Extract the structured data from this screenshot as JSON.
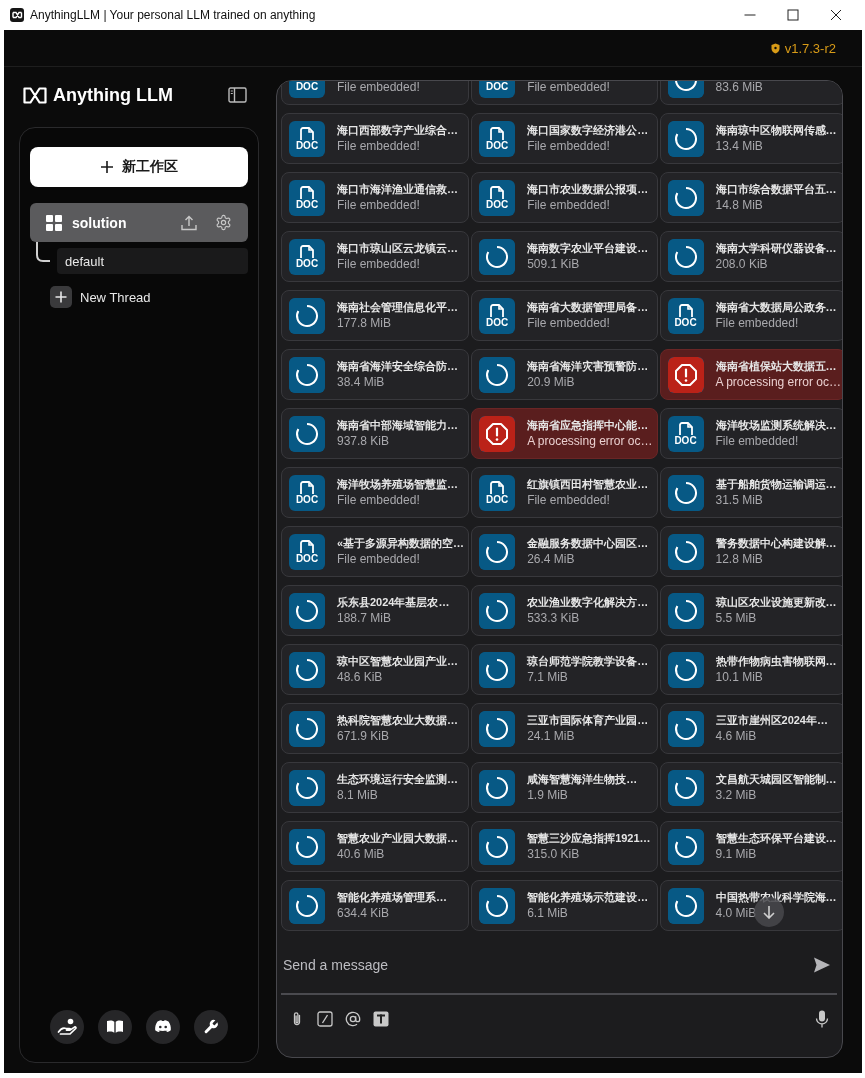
{
  "window": {
    "title": "AnythingLLM | Your personal LLM trained on anything"
  },
  "header": {
    "version": "v1.7.3-r2"
  },
  "sidebar": {
    "logo": "Anything LLM",
    "new_workspace_button": "新工作区",
    "workspaces": [
      {
        "name": "solution",
        "selected": true,
        "threads": [
          {
            "name": "default",
            "selected": true
          }
        ]
      }
    ],
    "new_thread_button": "New Thread"
  },
  "files": [
    {
      "kind": "doc",
      "icon_label": "DOC",
      "status": "File embedded!"
    },
    {
      "kind": "doc",
      "icon_label": "DOC",
      "status": "File embedded!"
    },
    {
      "kind": "loading",
      "status": "83.6 MiB"
    },
    {
      "kind": "doc",
      "icon_label": "DOC",
      "name": "海口西部数字产业综合…",
      "status": "File embedded!"
    },
    {
      "kind": "doc",
      "icon_label": "DOC",
      "name": "海口国家数字经济港公…",
      "status": "File embedded!"
    },
    {
      "kind": "loading",
      "name": "海南琼中区物联网传感…",
      "status": "13.4 MiB"
    },
    {
      "kind": "doc",
      "icon_label": "DOC",
      "name": "海口市海洋渔业通信救…",
      "status": "File embedded!"
    },
    {
      "kind": "doc",
      "icon_label": "DOC",
      "name": "海口市农业数据公报项…",
      "status": "File embedded!"
    },
    {
      "kind": "loading",
      "name": "海口市综合数据平台五…",
      "status": "14.8 MiB"
    },
    {
      "kind": "doc",
      "icon_label": "DOC",
      "name": "海口市琼山区云龙镇云…",
      "status": "File embedded!"
    },
    {
      "kind": "loading",
      "name": "海南数字农业平台建设…",
      "status": "509.1 KiB"
    },
    {
      "kind": "loading",
      "name": "海南大学科研仪器设备…",
      "status": "208.0 KiB"
    },
    {
      "kind": "loading",
      "name": "海南社会管理信息化平…",
      "status": "177.8 MiB"
    },
    {
      "kind": "doc",
      "icon_label": "DOC",
      "name": "海南省大数据管理局备…",
      "status": "File embedded!"
    },
    {
      "kind": "doc",
      "icon_label": "DOC",
      "name": "海南省大数据局公政务…",
      "status": "File embedded!"
    },
    {
      "kind": "loading",
      "name": "海南省海洋安全综合防…",
      "status": "38.4 MiB"
    },
    {
      "kind": "loading",
      "name": "海南省海洋灾害预警防…",
      "status": "20.9 MiB"
    },
    {
      "kind": "error",
      "name": "海南省植保站大数据五…",
      "status": "A processing error oc…"
    },
    {
      "kind": "loading",
      "name": "海南省中部海域智能力…",
      "status": "937.8 KiB"
    },
    {
      "kind": "error",
      "name": "海南省应急指挥中心能…",
      "status": "A processing error oc…"
    },
    {
      "kind": "doc",
      "icon_label": "DOC",
      "name": "海洋牧场监测系统解决…",
      "status": "File embedded!"
    },
    {
      "kind": "doc",
      "icon_label": "DOC",
      "name": "海洋牧场养殖场智慧监…",
      "status": "File embedded!"
    },
    {
      "kind": "doc",
      "icon_label": "DOC",
      "name": "红旗镇西田村智慧农业…",
      "status": "File embedded!"
    },
    {
      "kind": "loading",
      "name": "基于船舶货物运输调运…",
      "status": "31.5 MiB"
    },
    {
      "kind": "doc",
      "icon_label": "DOC",
      "name": "«基于多源异构数据的空…",
      "status": "File embedded!"
    },
    {
      "kind": "loading",
      "name": "金融服务数据中心园区…",
      "status": "26.4 MiB"
    },
    {
      "kind": "loading",
      "name": "警务数据中心构建设解…",
      "status": "12.8 MiB"
    },
    {
      "kind": "loading",
      "name": "乐东县2024年基层农…",
      "status": "188.7 MiB"
    },
    {
      "kind": "loading",
      "name": "农业渔业数字化解决方…",
      "status": "533.3 KiB"
    },
    {
      "kind": "loading",
      "name": "琼山区农业设施更新改…",
      "status": "5.5 MiB"
    },
    {
      "kind": "loading",
      "name": "琼中区智慧农业园产业…",
      "status": "48.6 KiB"
    },
    {
      "kind": "loading",
      "name": "琼台师范学院教学设备…",
      "status": "7.1 MiB"
    },
    {
      "kind": "loading",
      "name": "热带作物病虫害物联网…",
      "status": "10.1 MiB"
    },
    {
      "kind": "loading",
      "name": "热科院智慧农业大数据…",
      "status": "671.9 KiB"
    },
    {
      "kind": "loading",
      "name": "三亚市国际体育产业园…",
      "status": "24.1 MiB"
    },
    {
      "kind": "loading",
      "name": "三亚市崖州区2024年…",
      "status": "4.6 MiB"
    },
    {
      "kind": "loading",
      "name": "生态环境运行安全监测…",
      "status": "8.1 MiB"
    },
    {
      "kind": "loading",
      "name": "咸海智慧海洋生物技…",
      "status": "1.9 MiB"
    },
    {
      "kind": "loading",
      "name": "文昌航天城园区智能制…",
      "status": "3.2 MiB"
    },
    {
      "kind": "loading",
      "name": "智慧农业产业园大数据…",
      "status": "40.6 MiB"
    },
    {
      "kind": "loading",
      "name": "智慧三沙应急指挥1921…",
      "status": "315.0 KiB"
    },
    {
      "kind": "loading",
      "name": "智慧生态环保平台建设…",
      "status": "9.1 MiB"
    },
    {
      "kind": "loading",
      "name": "智能化养殖场管理系…",
      "status": "634.4 KiB"
    },
    {
      "kind": "loading",
      "name": "智能化养殖场示范建设…",
      "status": "6.1 MiB"
    },
    {
      "kind": "loading",
      "name": "中国热带农业科学院海…",
      "status": "4.0 MiB"
    }
  ],
  "composer": {
    "placeholder": "Send a message"
  }
}
